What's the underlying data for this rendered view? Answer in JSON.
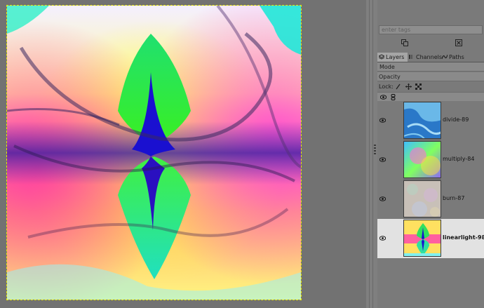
{
  "tags": {
    "placeholder": "enter tags"
  },
  "tabs": [
    {
      "label": "Layers",
      "icon": "layers-icon",
      "active": true
    },
    {
      "label": "Channels",
      "icon": "channels-icon",
      "active": false
    },
    {
      "label": "Paths",
      "icon": "paths-icon",
      "active": false
    }
  ],
  "panel": {
    "mode_label": "Mode",
    "opacity_label": "Opacity",
    "lock_label": "Lock:"
  },
  "layers": [
    {
      "name": "divide-89",
      "visible": true,
      "selected": false
    },
    {
      "name": "multiply-84",
      "visible": true,
      "selected": false
    },
    {
      "name": "burn-87",
      "visible": true,
      "selected": false
    },
    {
      "name": "linearlight-98",
      "visible": true,
      "selected": true
    }
  ],
  "colors": {
    "canvas_bg": "#727272",
    "dock_bg": "#7a7a7a",
    "selection_outline": "#e6e600",
    "selected_row": "#e2e2e2"
  }
}
